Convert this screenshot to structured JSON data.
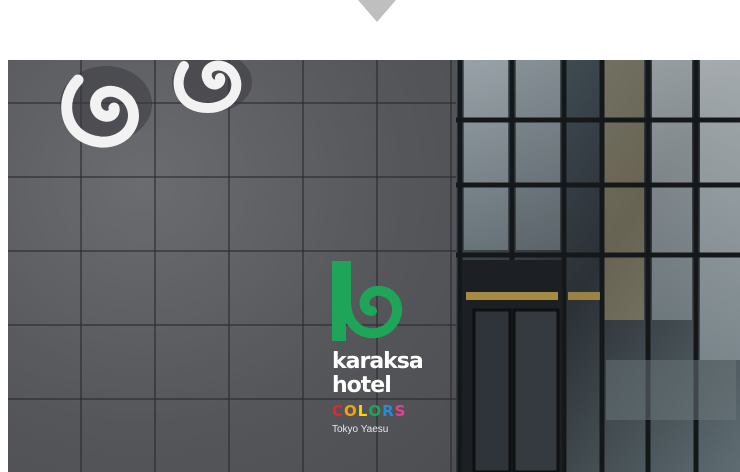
{
  "page": {
    "background_color": "#ffffff",
    "arrow_color": "#bfbfbf",
    "arrow_icon": "down-arrow-icon"
  },
  "photo": {
    "wall_color": "#5c5d61",
    "glass_color": "#2b3136",
    "sign": {
      "logo_icon": "spiral-logo-icon",
      "logo_color": "#1fa55a",
      "brand_line_1": "karaksa",
      "brand_line_2": "hotel",
      "sub_brand_letters": [
        {
          "char": "C",
          "color": "#e8242c"
        },
        {
          "char": "O",
          "color": "#f5a300"
        },
        {
          "char": "L",
          "color": "#ffd500"
        },
        {
          "char": "O",
          "color": "#1fa55a"
        },
        {
          "char": "R",
          "color": "#2b8ad8"
        },
        {
          "char": "S",
          "color": "#e83e8c"
        }
      ],
      "location": "Tokyo Yaesu"
    }
  }
}
